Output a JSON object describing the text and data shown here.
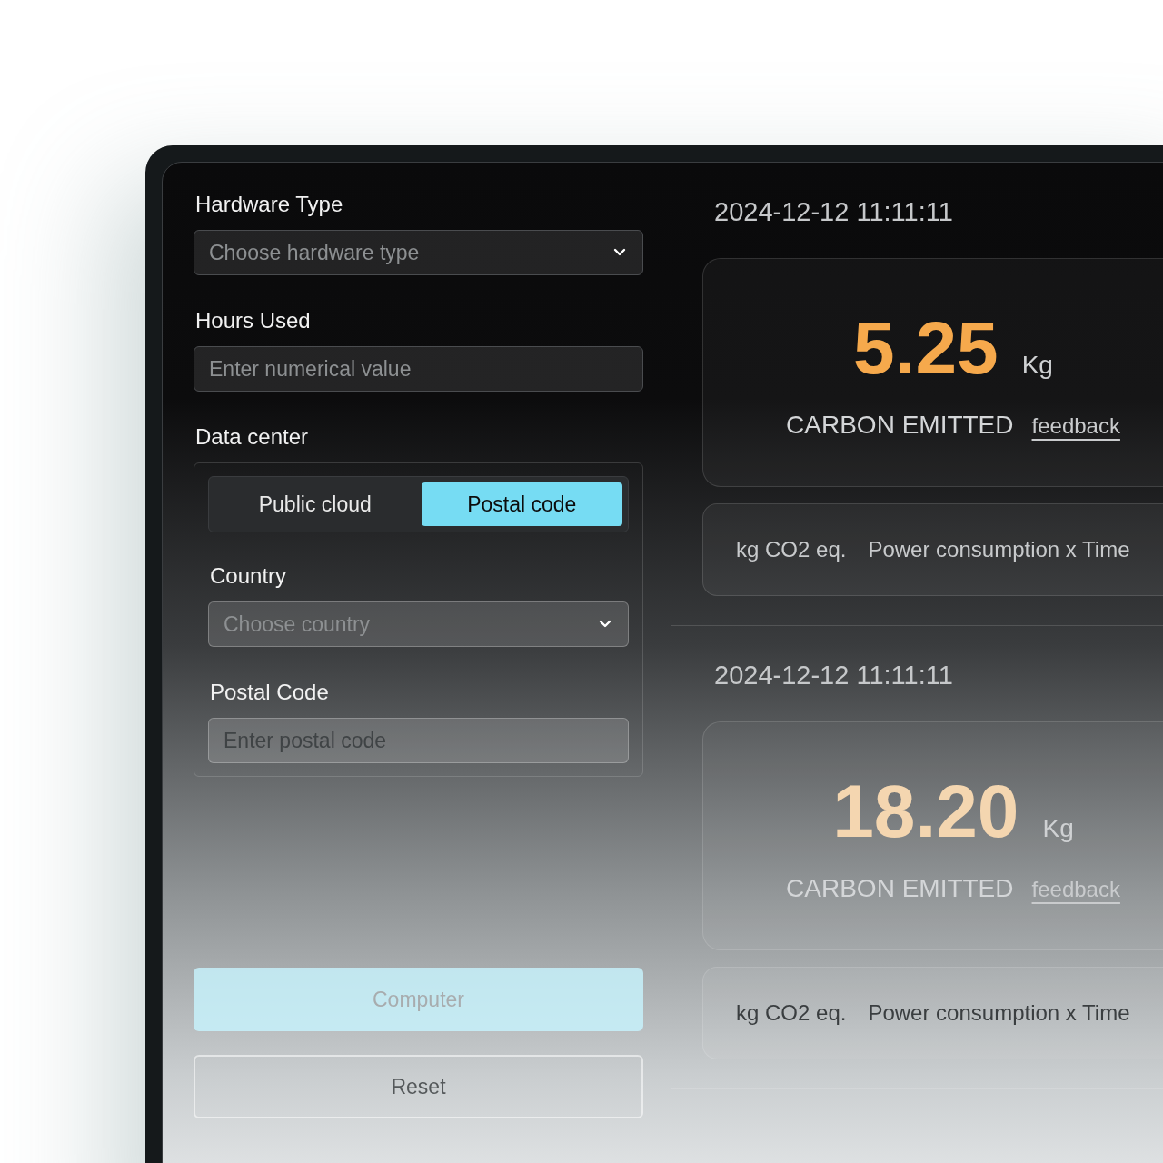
{
  "form": {
    "hardware": {
      "label": "Hardware Type",
      "placeholder": "Choose hardware type"
    },
    "hours": {
      "label": "Hours Used",
      "placeholder": "Enter numerical value"
    },
    "data_center": {
      "label": "Data center",
      "tabs": [
        {
          "label": "Public cloud",
          "selected": false
        },
        {
          "label": "Postal code",
          "selected": true
        }
      ],
      "country": {
        "label": "Country",
        "placeholder": "Choose country"
      },
      "postal": {
        "label": "Postal Code",
        "placeholder": "Enter postal code"
      }
    },
    "buttons": [
      {
        "kind": "primary",
        "label": "Computer"
      },
      {
        "kind": "outline",
        "label": "Reset"
      }
    ]
  },
  "results": [
    {
      "timestamp": "2024-12-12 11:11:11",
      "value": "5.25",
      "color": "#f6a94c",
      "unit": "Kg",
      "label": "CARBON EMITTED",
      "link": "feedback",
      "unit_text": "kg CO2 eq.",
      "formula": "Power consumption x Time"
    },
    {
      "timestamp": "2024-12-12 11:11:11",
      "value": "18.20",
      "color": "#f4d6b0",
      "unit": "Kg",
      "label": "CARBON EMITTED",
      "link": "feedback",
      "unit_text": "kg CO2 eq.",
      "formula": "Power consumption x Time"
    }
  ]
}
